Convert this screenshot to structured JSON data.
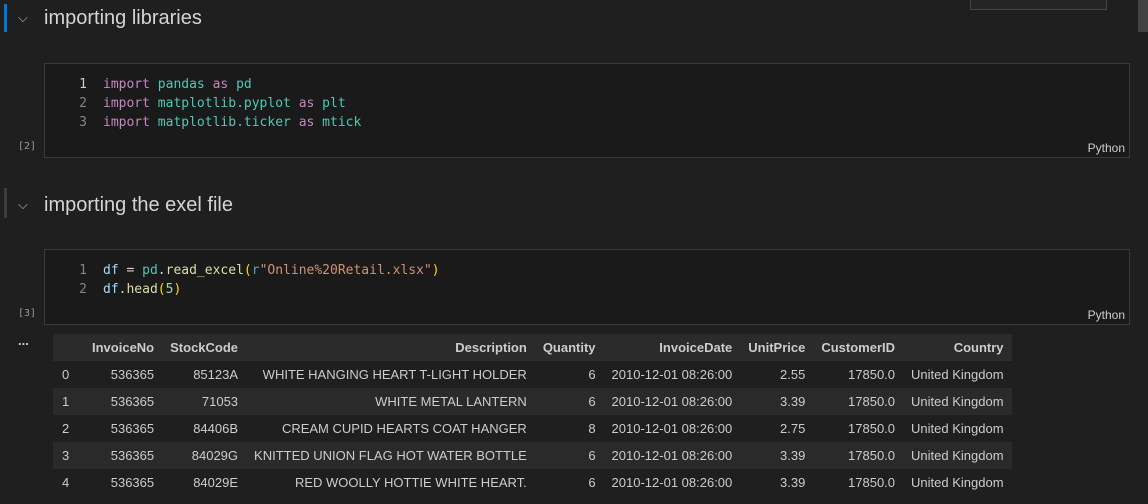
{
  "sections": [
    {
      "title": "importing libraries",
      "exec_count": "[2]",
      "language": "Python",
      "lines": [
        "1",
        "2",
        "3"
      ]
    },
    {
      "title": "importing the exel file",
      "exec_count": "[3]",
      "language": "Python",
      "lines": [
        "1",
        "2"
      ]
    }
  ],
  "code1": {
    "l1": [
      "import",
      "pandas",
      "as",
      "pd"
    ],
    "l2": [
      "import",
      "matplotlib.pyplot",
      "as",
      "plt"
    ],
    "l3": [
      "import",
      "matplotlib.ticker",
      "as",
      "mtick"
    ]
  },
  "code2": {
    "l1": [
      "df",
      " = ",
      "pd",
      ".",
      "read_excel",
      "(",
      "r",
      "\"Online%20Retail.xlsx\"",
      ")"
    ],
    "l2": [
      "df",
      ".",
      "head",
      "(",
      "5",
      ")"
    ]
  },
  "output": {
    "more": "...",
    "columns": [
      "",
      "InvoiceNo",
      "StockCode",
      "Description",
      "Quantity",
      "InvoiceDate",
      "UnitPrice",
      "CustomerID",
      "Country"
    ],
    "rows": [
      [
        "0",
        "536365",
        "85123A",
        "WHITE HANGING HEART T-LIGHT HOLDER",
        "6",
        "2010-12-01 08:26:00",
        "2.55",
        "17850.0",
        "United Kingdom"
      ],
      [
        "1",
        "536365",
        "71053",
        "WHITE METAL LANTERN",
        "6",
        "2010-12-01 08:26:00",
        "3.39",
        "17850.0",
        "United Kingdom"
      ],
      [
        "2",
        "536365",
        "84406B",
        "CREAM CUPID HEARTS COAT HANGER",
        "8",
        "2010-12-01 08:26:00",
        "2.75",
        "17850.0",
        "United Kingdom"
      ],
      [
        "3",
        "536365",
        "84029G",
        "KNITTED UNION FLAG HOT WATER BOTTLE",
        "6",
        "2010-12-01 08:26:00",
        "3.39",
        "17850.0",
        "United Kingdom"
      ],
      [
        "4",
        "536365",
        "84029E",
        "RED WOOLLY HOTTIE WHITE HEART.",
        "6",
        "2010-12-01 08:26:00",
        "3.39",
        "17850.0",
        "United Kingdom"
      ]
    ]
  }
}
